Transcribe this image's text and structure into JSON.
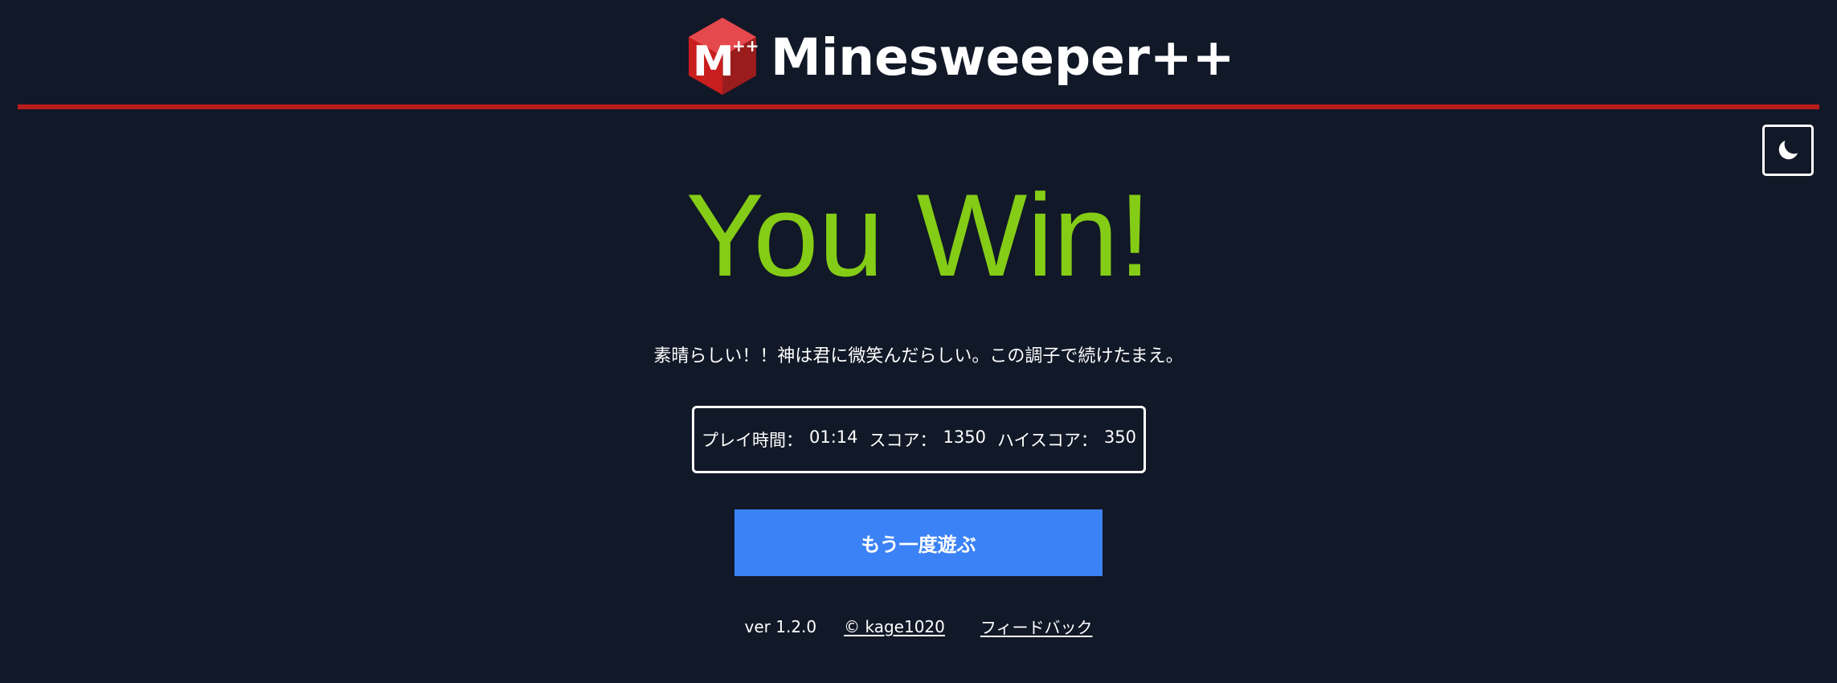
{
  "header": {
    "brand_title": "Minesweeper++",
    "logo_letter": "M",
    "logo_superscript": "++",
    "accent_color": "#b91c1c",
    "logo_icon": "hexagon-logo-icon"
  },
  "theme_toggle": {
    "icon": "moon-icon"
  },
  "result": {
    "title": "You Win!",
    "title_color": "#84cc16",
    "message": "素晴らしい！！神は君に微笑んだらしい。この調子で続けたまえ。"
  },
  "stats": {
    "play_time_label": "プレイ時間：",
    "play_time_value": "01:14",
    "score_label": "スコア：",
    "score_value": "1350",
    "high_score_label": "ハイスコア：",
    "high_score_value": "350"
  },
  "actions": {
    "play_again_label": "もう一度遊ぶ",
    "play_again_color": "#3b82f6"
  },
  "footer": {
    "version": "ver 1.2.0",
    "copyright": "© kage1020",
    "feedback": "フィードバック"
  },
  "colors": {
    "background": "#111827",
    "text": "#ffffff"
  }
}
